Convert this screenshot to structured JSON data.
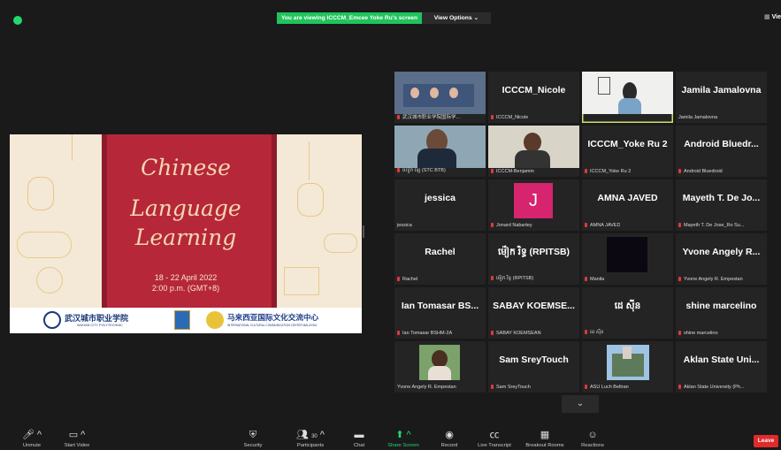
{
  "banner": {
    "text": "You are viewing ICCCM_Emcee Yoke Ru's screen",
    "view_options": "View Options ⌄",
    "view_right": "Vie"
  },
  "slide": {
    "title_lines": [
      "Chinese",
      "Language",
      "Learning"
    ],
    "date": "18 - 22 April 2022",
    "time": "2:00 p.m. (GMT+8)",
    "logo1_cn": "武汉城市职业学院",
    "logo1_en": "WUHAN CITY POLYTECHNIC",
    "logo2_cn": "马来西亚国际文化交流中心",
    "logo2_en": "INTERNATIONAL CULTURAL COMMUNICATION CENTER MALAYSIA"
  },
  "tiles": [
    {
      "big": "",
      "label": "武汉城市职业学院国际学...",
      "video": true
    },
    {
      "big": "ICCCM_Nicole",
      "label": "ICCCM_Nicole",
      "video": false
    },
    {
      "big": "",
      "label": "ICCCM_Emcee Yoke Ru",
      "video": true,
      "active": true
    },
    {
      "big": "Jamila Jamalovna",
      "label": "Jamila Jamalovna",
      "video": false
    },
    {
      "big": "",
      "label": "ហៀក ឡេ (STC BTB)",
      "video": true
    },
    {
      "big": "",
      "label": "ICCCM-Benjamin",
      "video": true
    },
    {
      "big": "ICCCM_Yoke Ru 2",
      "label": "ICCCM_Yoke Ru 2",
      "video": false
    },
    {
      "big": "Android Bluedr...",
      "label": "Android Bluedroid",
      "video": false
    },
    {
      "big": "jessica",
      "label": "jessica",
      "video": false
    },
    {
      "big": "J",
      "label": "Jonard Nabartey",
      "video": false,
      "avatar": true
    },
    {
      "big": "AMNA JAVED",
      "label": "AMNA JAVED",
      "video": false
    },
    {
      "big": "Mayeth T. De Jo...",
      "label": "Mayeth T. De Jose_Ro Su...",
      "video": false
    },
    {
      "big": "Rachel",
      "label": "Rachel",
      "video": false
    },
    {
      "big": "ម៉ៀក រិទ្ធ (RPITSB)",
      "label": "ម៉ៀក រិទ្ធ (RPITSB)",
      "video": false
    },
    {
      "big": "",
      "label": "Manila",
      "video": false,
      "dark": true
    },
    {
      "big": "Yvone Angely R...",
      "label": "Yvone Angely R. Empestan",
      "video": false
    },
    {
      "big": "Ian Tomasar BS...",
      "label": "Ian Tomasar BSHM-2A",
      "video": false
    },
    {
      "big": "SABAY KOEMSE...",
      "label": "SABAY KOEMSEAN",
      "video": false
    },
    {
      "big": "ដេ ស៊ីន",
      "label": "ដេ ស៊ីន",
      "video": false
    },
    {
      "big": "shine marcelino",
      "label": "shine marcelino",
      "video": false
    },
    {
      "big": "",
      "label": "Yvone Angely R. Empestan",
      "video": true
    },
    {
      "big": "Sam SreyTouch",
      "label": "Sam SreyTouch",
      "video": false
    },
    {
      "big": "",
      "label": "ASU Luch Beltran",
      "video": true
    },
    {
      "big": "Aklan State Uni...",
      "label": "Aklan State University (Ph...",
      "video": false
    }
  ],
  "toolbar": {
    "unmute": "Unmute",
    "start_video": "Start Video",
    "security": "Security",
    "participants": "Participants",
    "participants_count": "30",
    "chat": "Chat",
    "share": "Share Screen",
    "record": "Record",
    "transcript": "Live Transcript",
    "breakout": "Breakout Rooms",
    "reactions": "Reactions",
    "leave": "Leave"
  }
}
